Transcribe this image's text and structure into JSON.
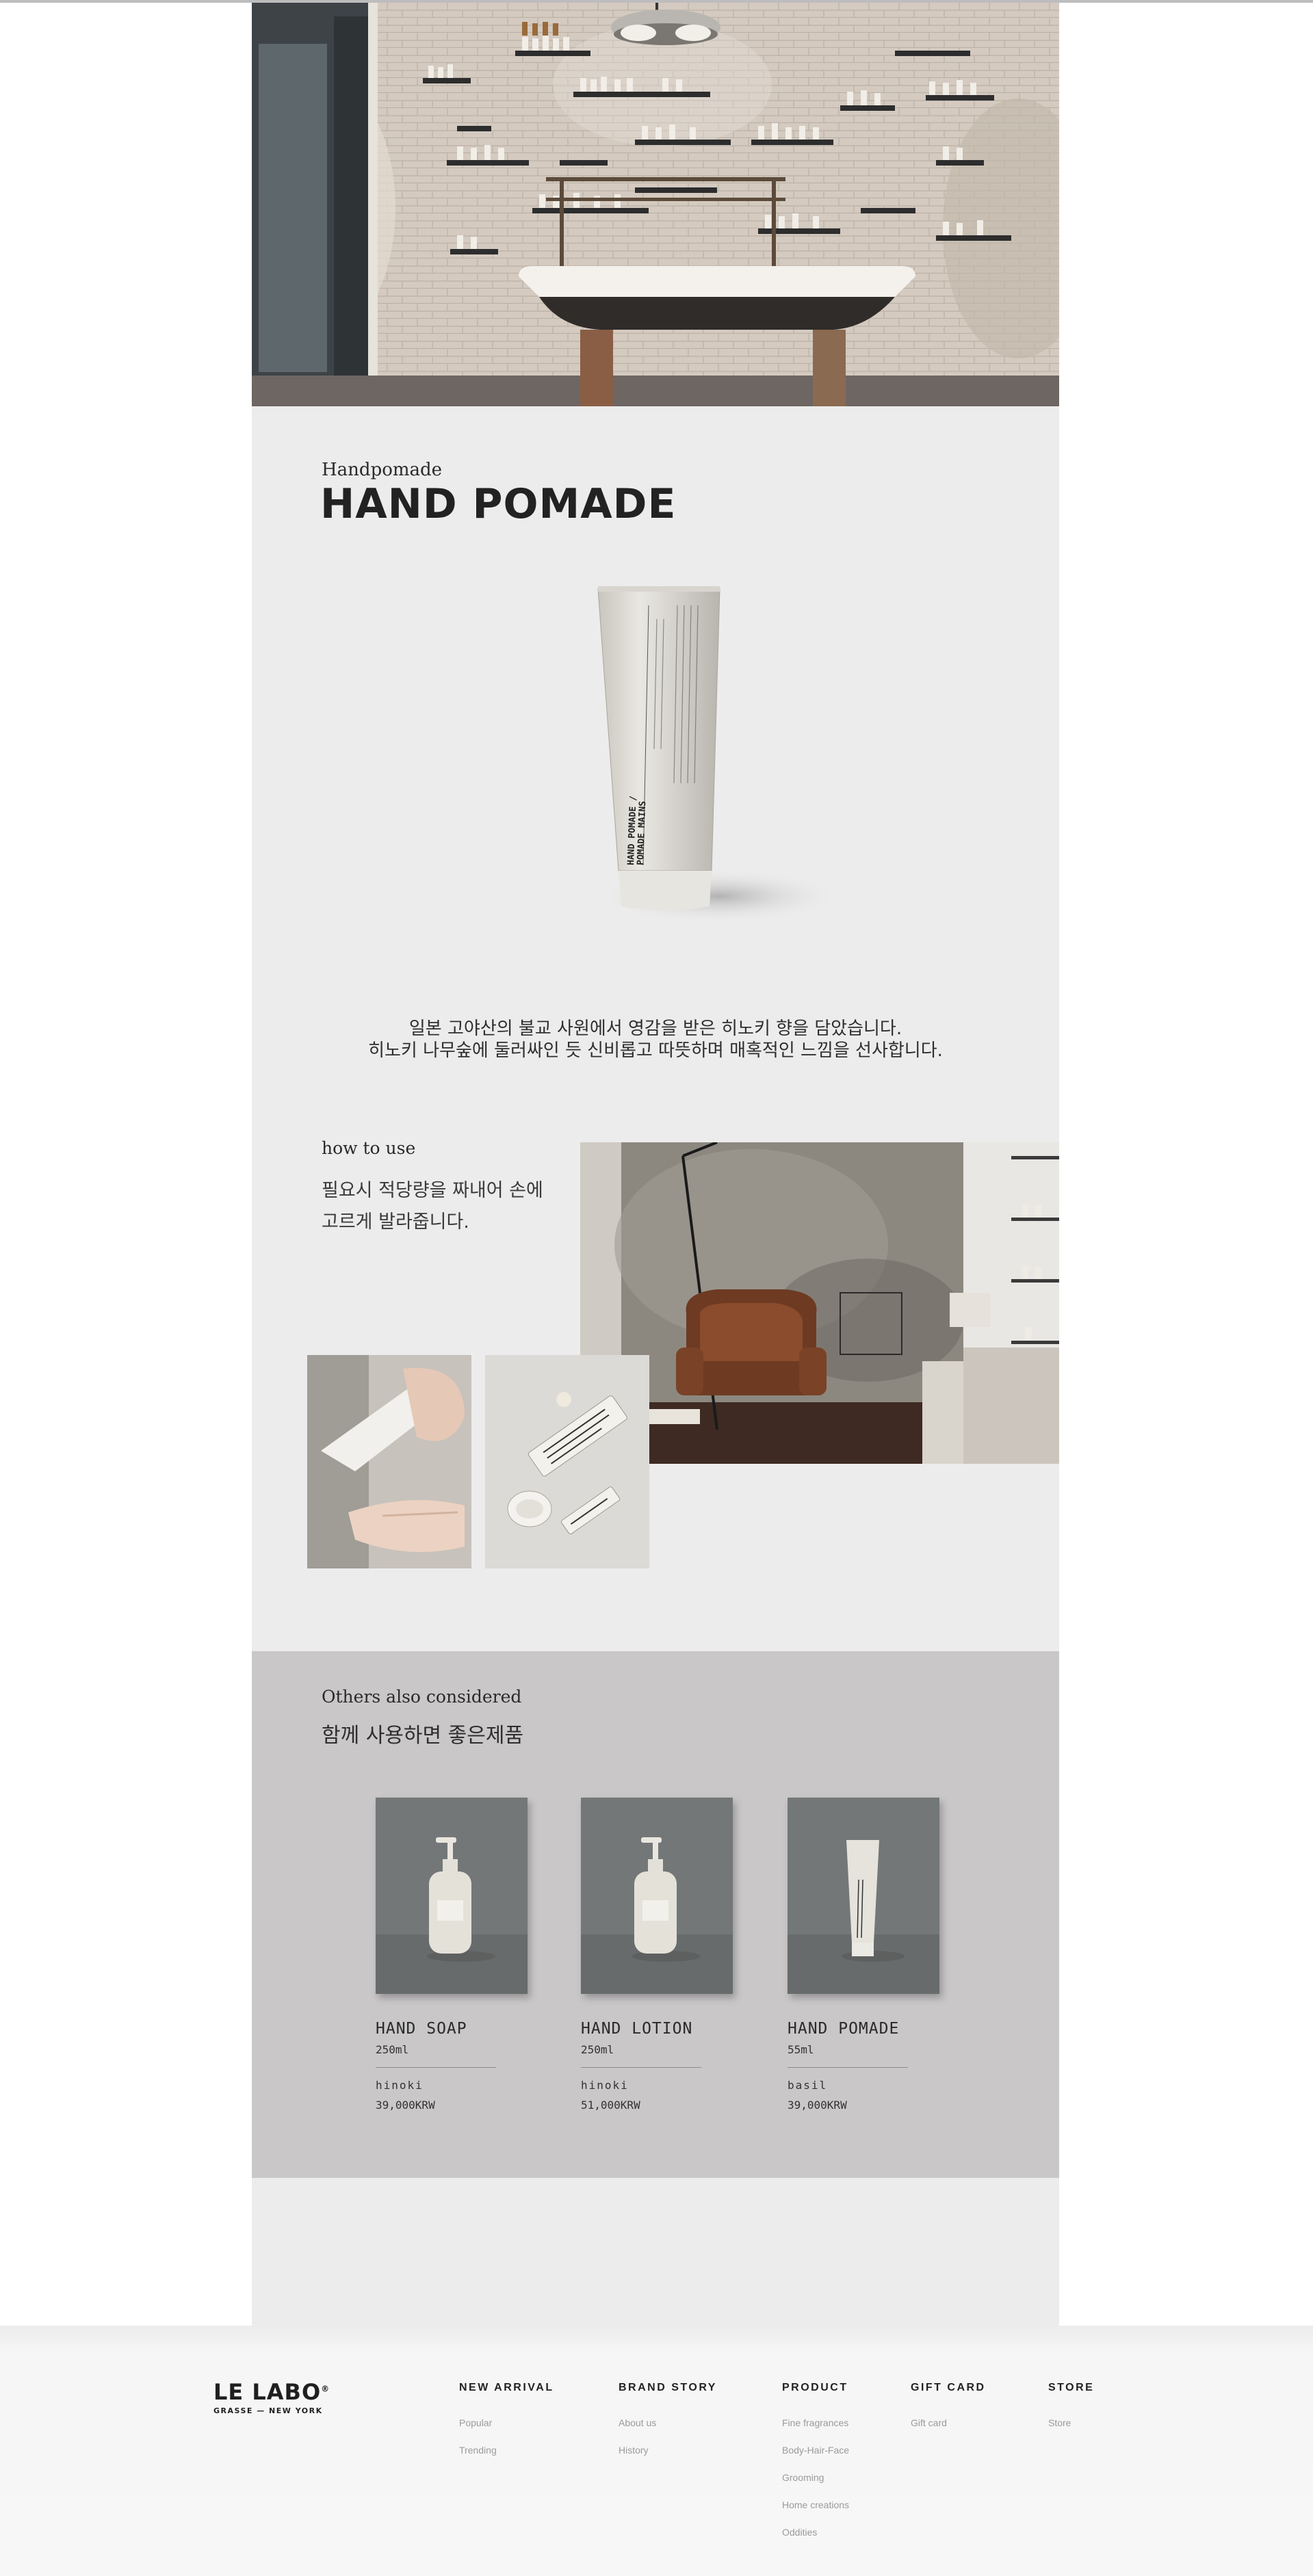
{
  "hero": {
    "image": "store-interior-photo"
  },
  "product": {
    "eyebrow": "Handpomade",
    "title": "HAND POMADE",
    "tube_label_1": "HAND POMADE /",
    "tube_label_2": "POMADE MAINS",
    "description_line1": "일본 고야산의 불교 사원에서 영감을 받은 히노키 향을 담았습니다.",
    "description_line2": "히노키 나무숲에 둘러싸인 듯 신비롭고 따뜻하며 매혹적인 느낌을 선사합니다."
  },
  "howto": {
    "title": "how to use",
    "line1": "필요시 적당량을 짜내어 손에",
    "line2": "고르게 발라줍니다."
  },
  "others": {
    "title": "Others also considered",
    "subtitle": "함께 사용하면 좋은제품",
    "items": [
      {
        "name": "HAND SOAP",
        "size": "250ml",
        "scent": "hinoki",
        "price": "39,000KRW",
        "image": "hand-soap-bottle"
      },
      {
        "name": "HAND LOTION",
        "size": "250ml",
        "scent": "hinoki",
        "price": "51,000KRW",
        "image": "hand-lotion-bottle"
      },
      {
        "name": "HAND POMADE",
        "size": "55ml",
        "scent": "basil",
        "price": "39,000KRW",
        "image": "hand-pomade-tube"
      }
    ]
  },
  "footer": {
    "logo": "LE LABO",
    "logo_mark": "®",
    "logo_sub": "GRASSE — NEW YORK",
    "columns": [
      {
        "heading": "NEW ARRIVAL",
        "links": [
          "Popular",
          "Trending"
        ]
      },
      {
        "heading": "BRAND STORY",
        "links": [
          "About us",
          "History"
        ]
      },
      {
        "heading": "PRODUCT",
        "links": [
          "Fine fragrances",
          "Body-Hair-Face",
          "Grooming",
          "Home creations",
          "Oddities"
        ]
      },
      {
        "heading": "GIFT CARD",
        "links": [
          "Gift card"
        ]
      },
      {
        "heading": "STORE",
        "links": [
          "Store"
        ]
      }
    ]
  },
  "colors": {
    "page_bg": "#ececec",
    "others_bg": "#c9c7c8",
    "text": "#2a2a2a",
    "footer_link": "#9a9a9a"
  }
}
